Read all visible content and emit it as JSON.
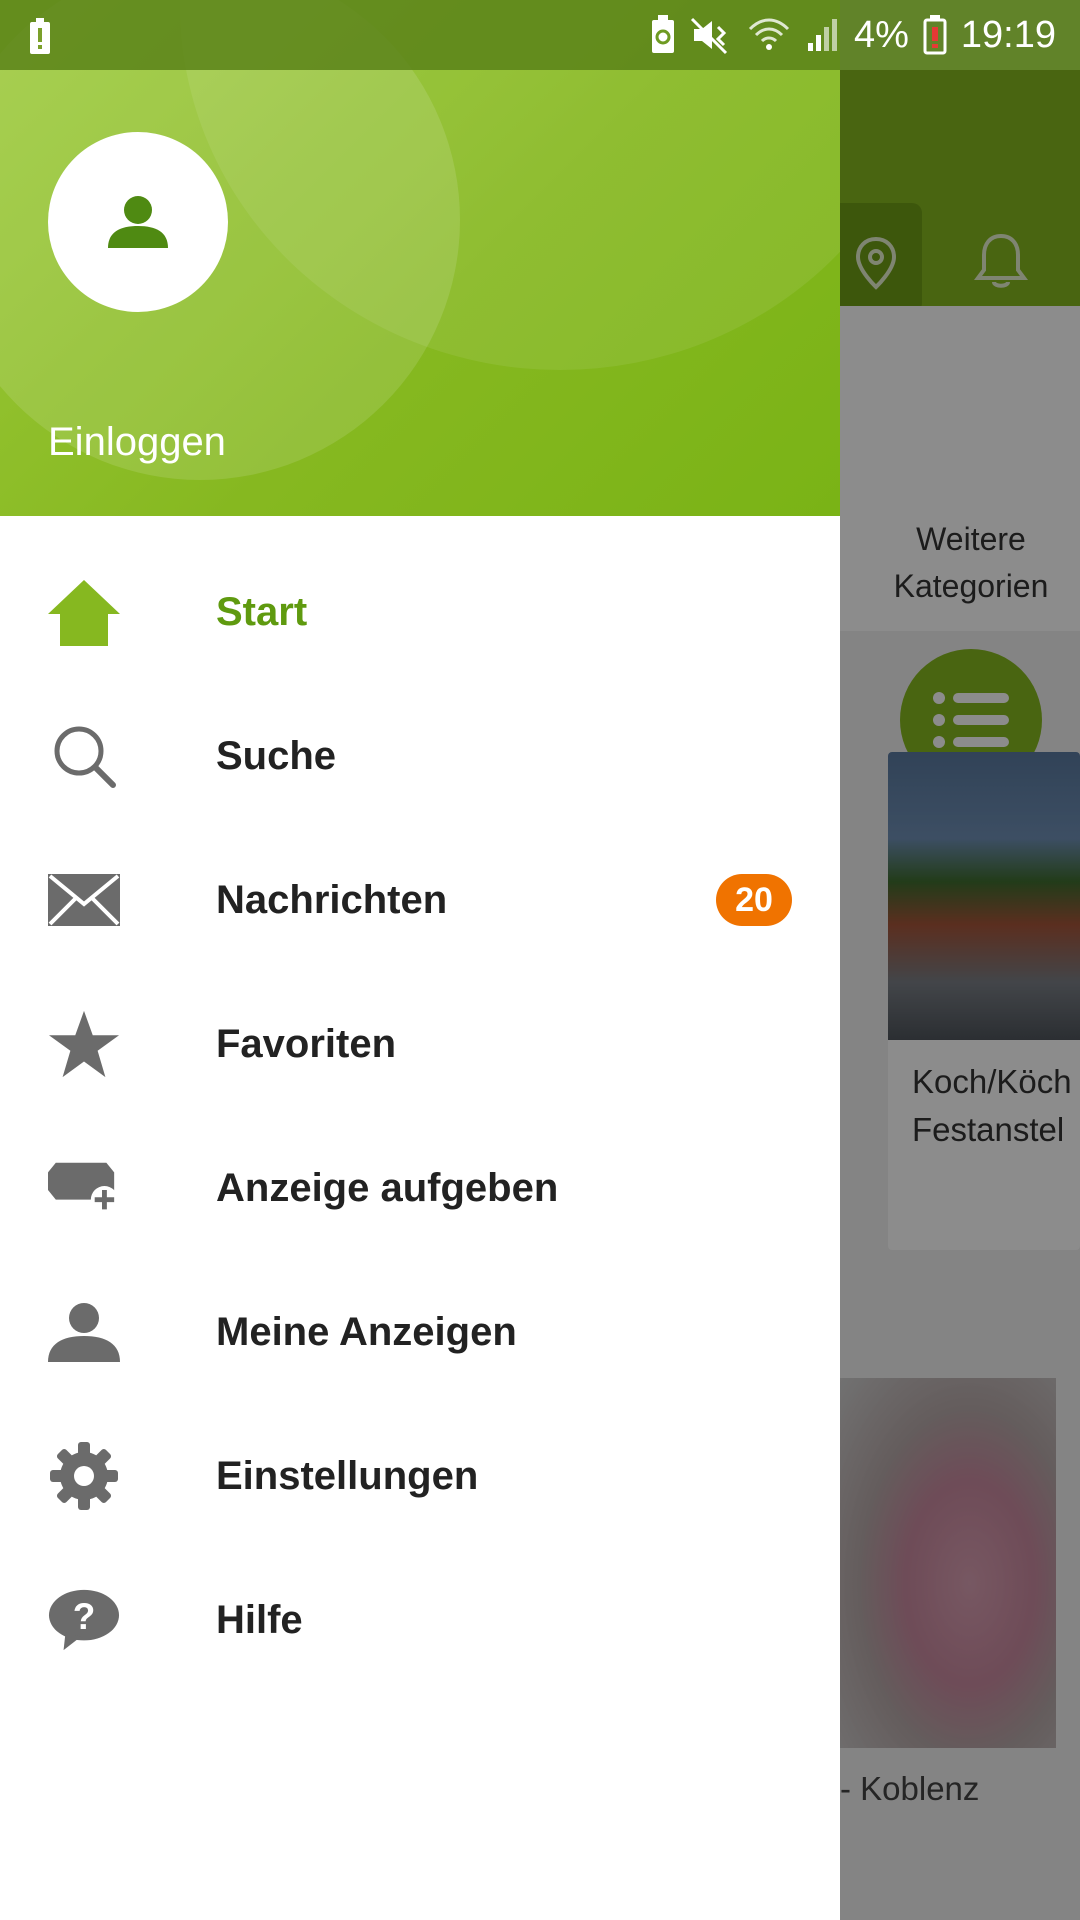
{
  "status_bar": {
    "battery_percent": "4%",
    "time": "19:19"
  },
  "drawer": {
    "header": {
      "login_label": "Einloggen"
    },
    "menu": [
      {
        "label": "Start",
        "icon": "home-icon",
        "active": true
      },
      {
        "label": "Suche",
        "icon": "search-icon"
      },
      {
        "label": "Nachrichten",
        "icon": "mail-icon",
        "badge": "20"
      },
      {
        "label": "Favoriten",
        "icon": "star-icon"
      },
      {
        "label": "Anzeige aufgeben",
        "icon": "add-ad-icon"
      },
      {
        "label": "Meine Anzeigen",
        "icon": "user-icon"
      },
      {
        "label": "Einstellungen",
        "icon": "gear-icon"
      },
      {
        "label": "Hilfe",
        "icon": "help-icon"
      }
    ]
  },
  "background": {
    "categories_label_line1": "Weitere",
    "categories_label_line2": "Kategorien",
    "card1_title_line1": "Koch/Köch",
    "card1_title_line2": "Festanstel",
    "card2_title": "- Koblenz"
  },
  "colors": {
    "accent": "#86b820",
    "active_text": "#5f9a0f",
    "badge": "#f07300"
  }
}
